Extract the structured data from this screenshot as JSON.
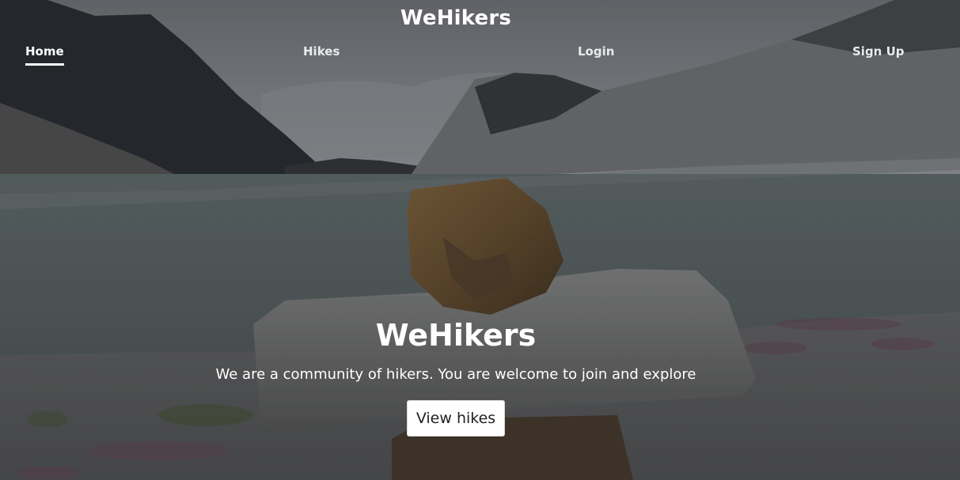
{
  "header": {
    "brand": "WeHikers"
  },
  "nav": {
    "items": [
      {
        "label": "Home",
        "active": true
      },
      {
        "label": "Hikes",
        "active": false
      },
      {
        "label": "Login",
        "active": false
      },
      {
        "label": "Sign Up",
        "active": false
      }
    ]
  },
  "hero": {
    "title": "WeHikers",
    "subtitle": "We are a community of hikers. You are welcome to join and explore",
    "cta_label": "View hikes"
  },
  "colors": {
    "overlay_text": "#ffffff",
    "button_bg": "#ffffff",
    "button_text": "#222222"
  }
}
